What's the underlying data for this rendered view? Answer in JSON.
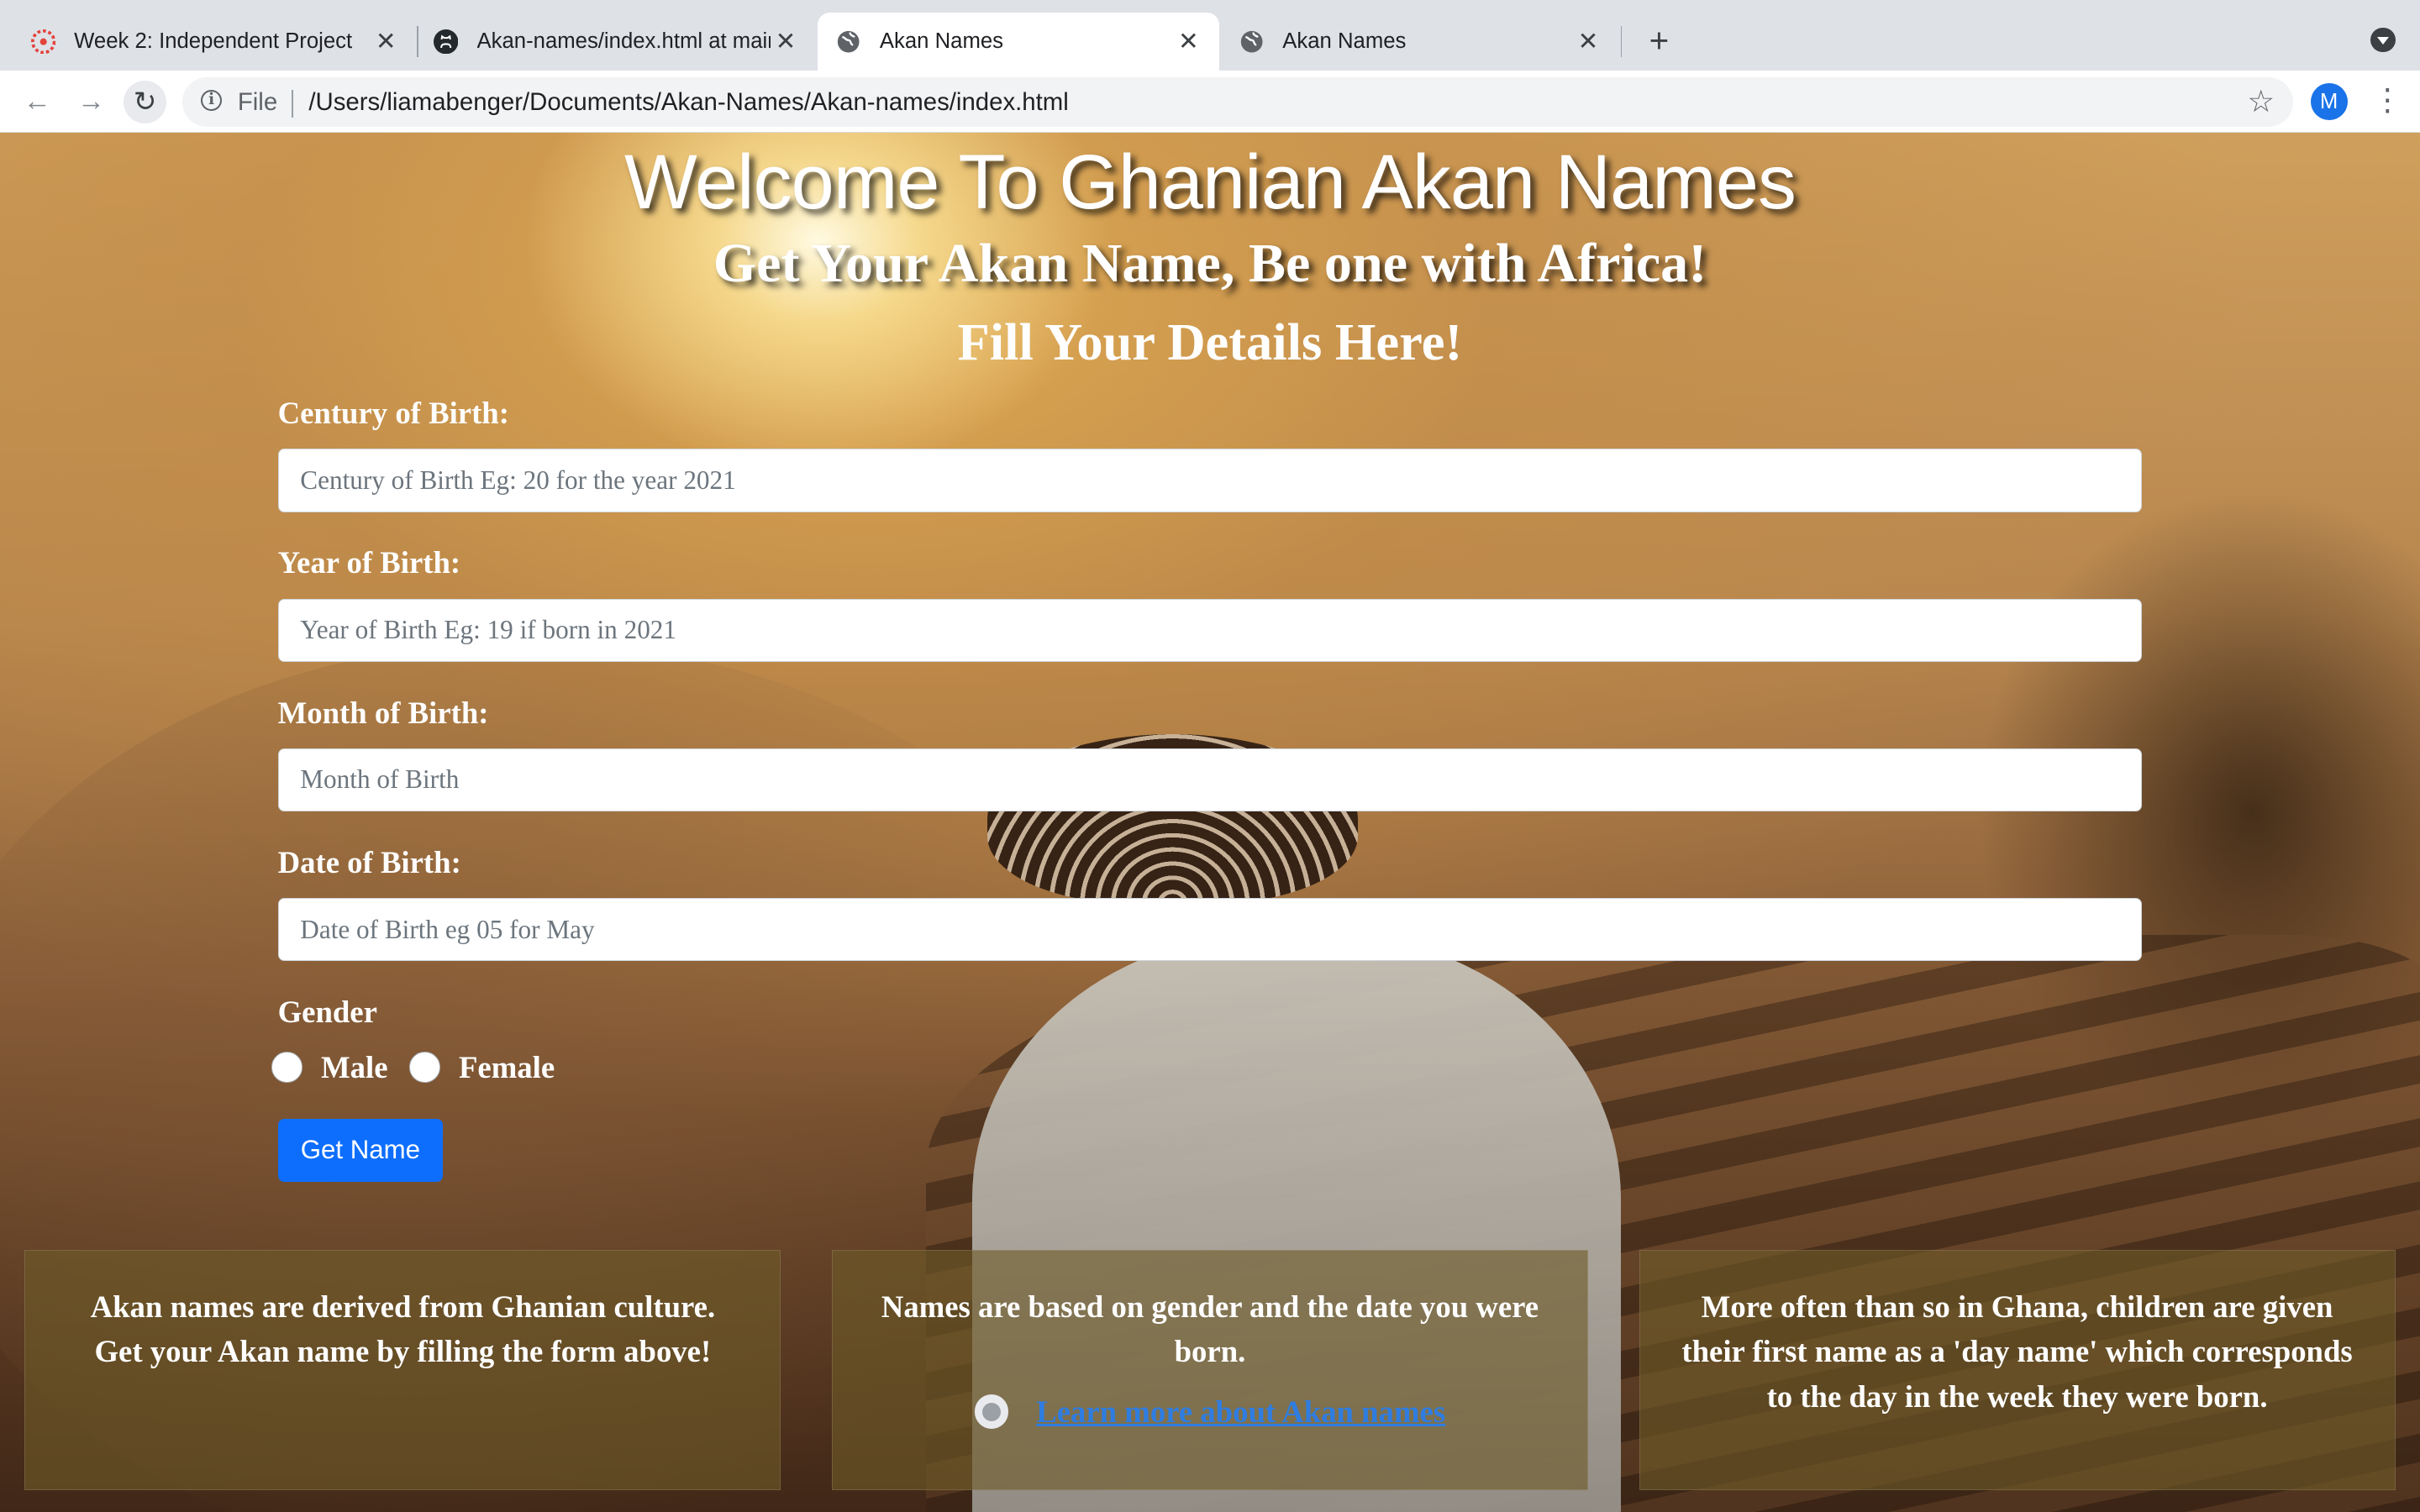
{
  "browser": {
    "tabs": [
      {
        "title": "Week 2: Independent Project",
        "icon": "canvas-lms-icon",
        "active": false
      },
      {
        "title": "Akan-names/index.html at main",
        "icon": "github-icon",
        "active": false
      },
      {
        "title": "Akan Names",
        "icon": "globe-icon",
        "active": true
      },
      {
        "title": "Akan Names",
        "icon": "globe-icon",
        "active": false
      }
    ],
    "scheme_label": "File",
    "url": "/Users/liamabenger/Documents/Akan-Names/Akan-names/index.html",
    "profile_initial": "M"
  },
  "page": {
    "title": "Welcome To Ghanian Akan Names",
    "subtitle": "Get Your Akan Name, Be one with Africa!",
    "form_heading": "Fill Your Details Here!",
    "fields": [
      {
        "label": "Century of Birth:",
        "placeholder": "Century of Birth Eg: 20 for the year 2021"
      },
      {
        "label": "Year of Birth:",
        "placeholder": "Year of Birth Eg: 19 if born in 2021"
      },
      {
        "label": "Month of Birth:",
        "placeholder": "Month of Birth"
      },
      {
        "label": "Date of Birth:",
        "placeholder": "Date of Birth eg 05 for May"
      }
    ],
    "gender": {
      "label": "Gender",
      "options": [
        "Male",
        "Female"
      ]
    },
    "submit_label": "Get Name",
    "cards": [
      {
        "text": "Akan names are derived from Ghanian culture. Get your Akan name by filling the form above!"
      },
      {
        "text": "Names are based on gender and the date you were born.",
        "link": "Learn more about Akan names"
      },
      {
        "text": "More often than so in Ghana, children are given their first name as a 'day name' which corresponds to the day in the week they were born."
      }
    ],
    "colors": {
      "primary_button": "#0d6efd",
      "link": "#2f7de1"
    }
  }
}
